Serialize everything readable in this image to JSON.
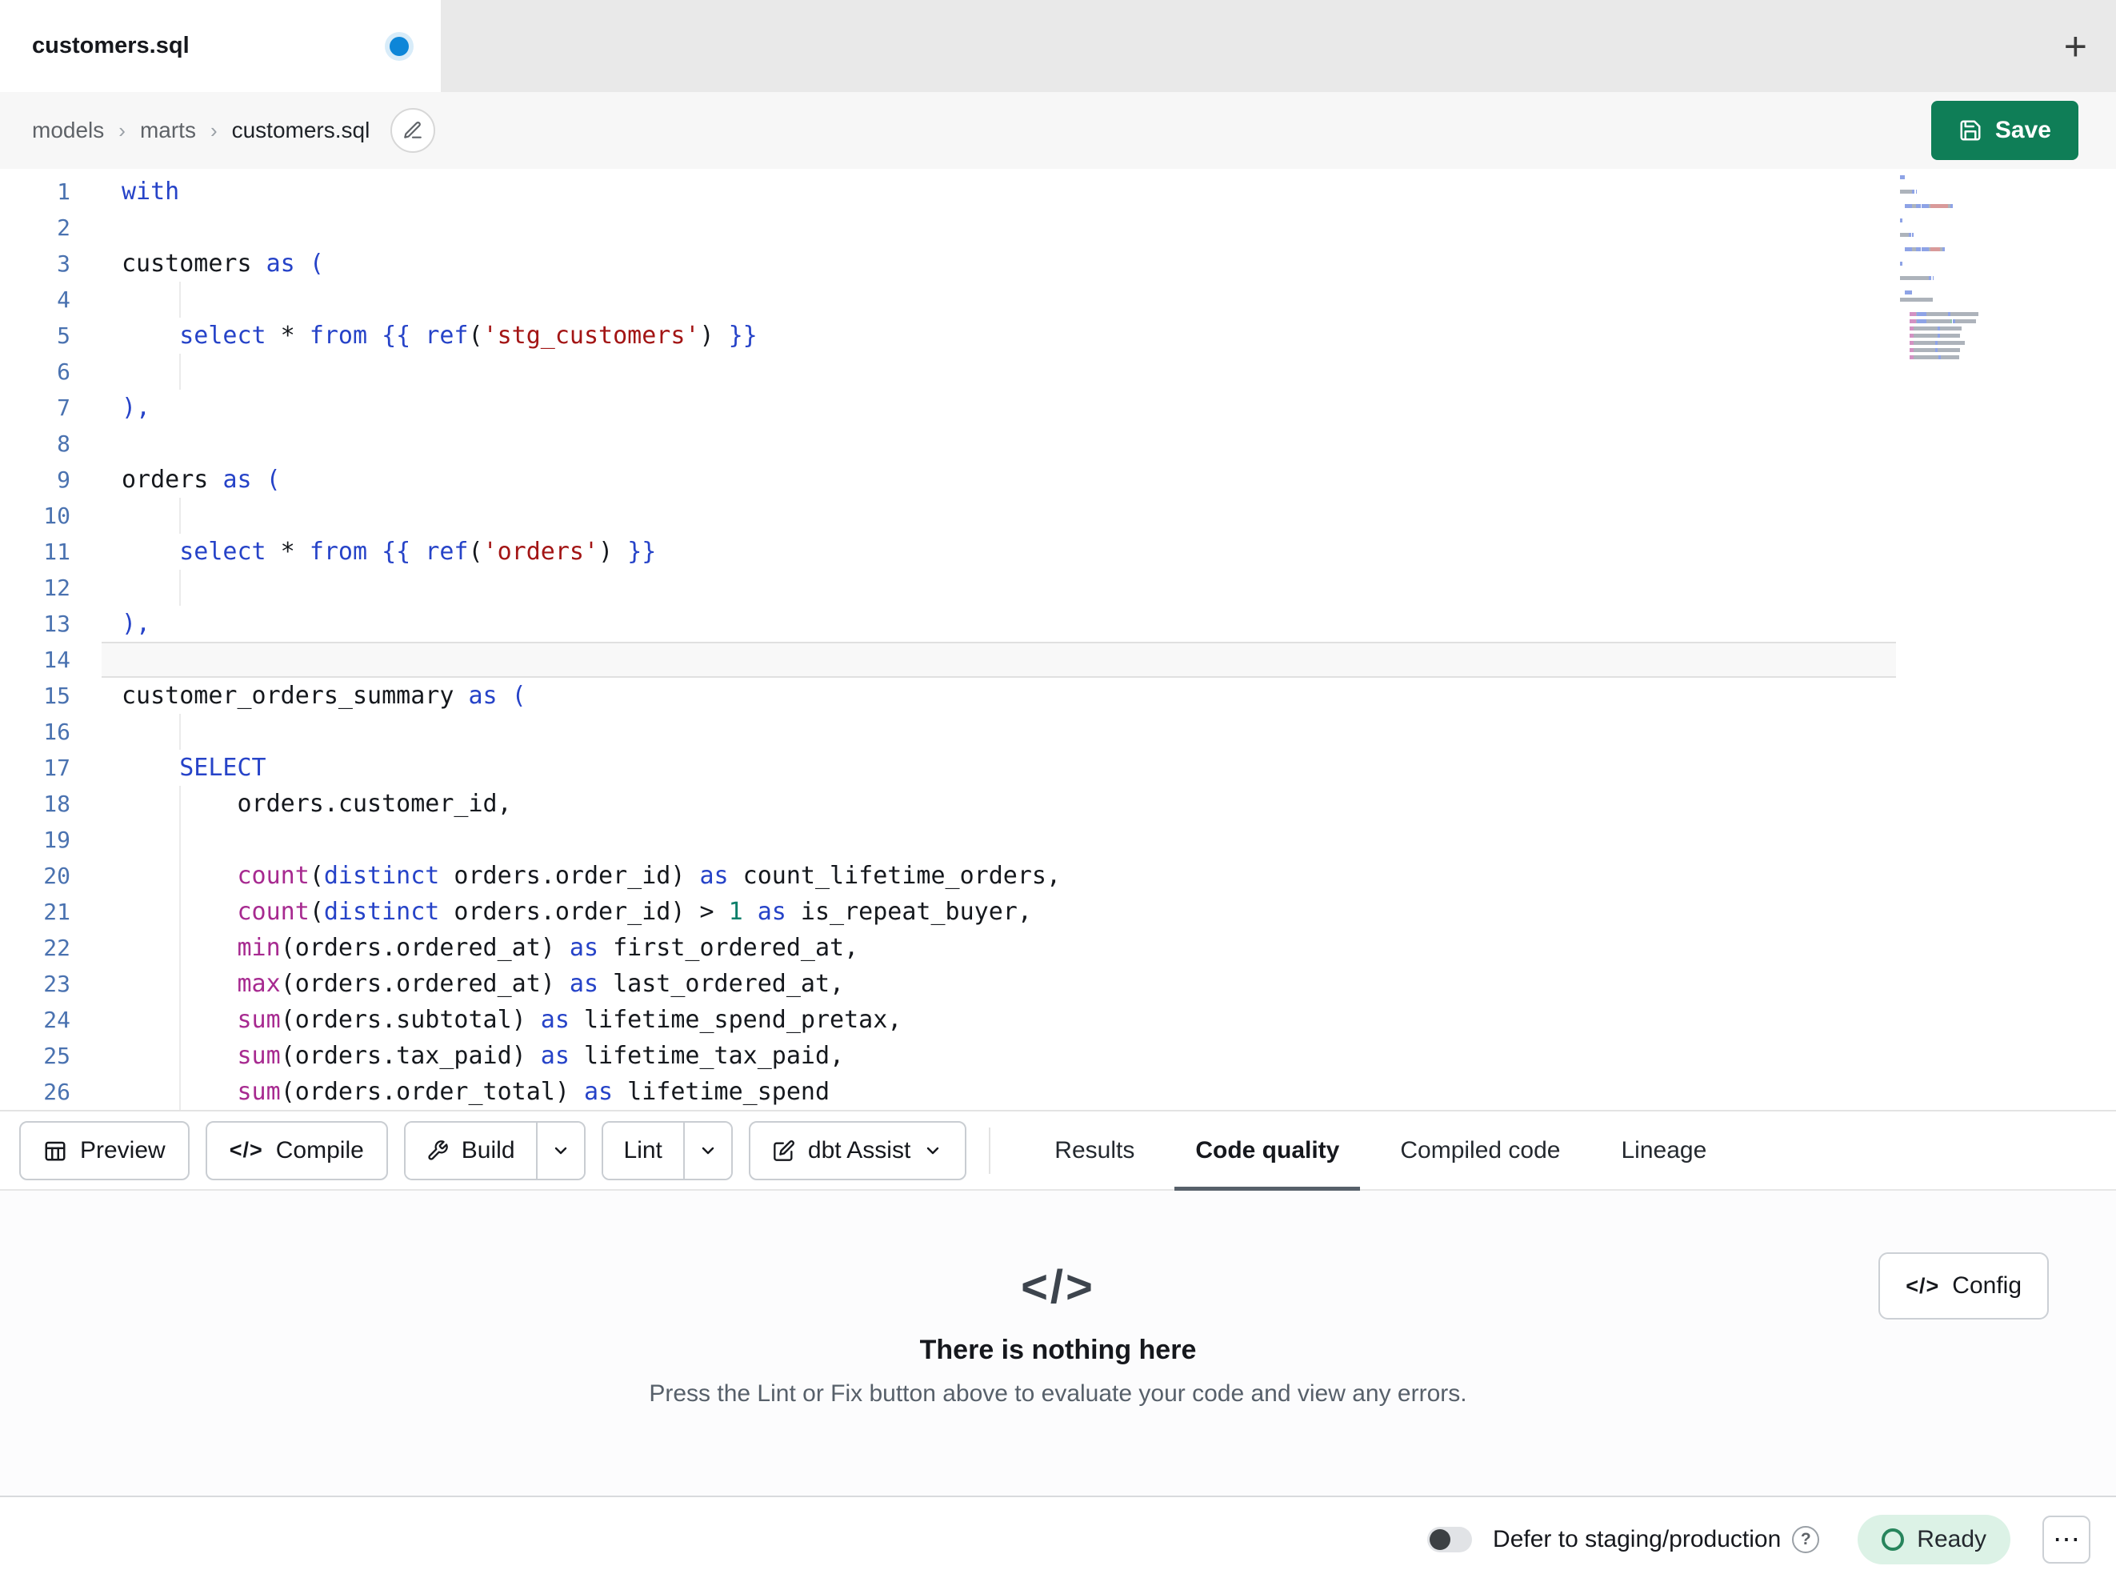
{
  "colors": {
    "accent_green": "#0f7e57",
    "keyword_blue": "#2643c8",
    "function_magenta": "#a72a90",
    "string_red": "#a31515",
    "number_teal": "#0b7f6a",
    "ready_green": "#27855c",
    "unsaved_dot_blue": "#0d86d8"
  },
  "window": {
    "tab_title": "customers.sql"
  },
  "icons": {
    "code_glyph": "</>",
    "plus_glyph": "+",
    "more_glyph": "⋯",
    "help_glyph": "?"
  },
  "breadcrumb": {
    "separator": "›",
    "items": [
      "models",
      "marts",
      "customers.sql"
    ]
  },
  "header": {
    "save_label": "Save"
  },
  "editor": {
    "lines": [
      {
        "n": 1,
        "t": [
          [
            "kw",
            "with"
          ]
        ]
      },
      {
        "n": 2,
        "t": []
      },
      {
        "n": 3,
        "t": [
          [
            "pl",
            "customers "
          ],
          [
            "kw",
            "as"
          ],
          [
            "pl",
            " "
          ],
          [
            "br",
            "("
          ]
        ]
      },
      {
        "n": 4,
        "t": [],
        "g": true
      },
      {
        "n": 5,
        "t": [
          [
            "pl",
            "    "
          ],
          [
            "kw",
            "select"
          ],
          [
            "pl",
            " * "
          ],
          [
            "kw",
            "from"
          ],
          [
            "pl",
            " "
          ],
          [
            "br",
            "{{ "
          ],
          [
            "kw",
            "ref"
          ],
          [
            "pl",
            "("
          ],
          [
            "st",
            "'stg_customers'"
          ],
          [
            "pl",
            ") "
          ],
          [
            "br",
            "}}"
          ]
        ]
      },
      {
        "n": 6,
        "t": [],
        "g": true
      },
      {
        "n": 7,
        "t": [
          [
            "br",
            "),"
          ]
        ]
      },
      {
        "n": 8,
        "t": []
      },
      {
        "n": 9,
        "t": [
          [
            "pl",
            "orders "
          ],
          [
            "kw",
            "as"
          ],
          [
            "pl",
            " "
          ],
          [
            "br",
            "("
          ]
        ]
      },
      {
        "n": 10,
        "t": [],
        "g": true
      },
      {
        "n": 11,
        "t": [
          [
            "pl",
            "    "
          ],
          [
            "kw",
            "select"
          ],
          [
            "pl",
            " * "
          ],
          [
            "kw",
            "from"
          ],
          [
            "pl",
            " "
          ],
          [
            "br",
            "{{ "
          ],
          [
            "kw",
            "ref"
          ],
          [
            "pl",
            "("
          ],
          [
            "st",
            "'orders'"
          ],
          [
            "pl",
            ") "
          ],
          [
            "br",
            "}}"
          ]
        ]
      },
      {
        "n": 12,
        "t": [],
        "g": true
      },
      {
        "n": 13,
        "t": [
          [
            "br",
            "),"
          ]
        ]
      },
      {
        "n": 14,
        "t": [],
        "a": true
      },
      {
        "n": 15,
        "t": [
          [
            "pl",
            "customer_orders_summary "
          ],
          [
            "kw",
            "as"
          ],
          [
            "pl",
            " "
          ],
          [
            "br",
            "("
          ]
        ]
      },
      {
        "n": 16,
        "t": [],
        "g": true
      },
      {
        "n": 17,
        "t": [
          [
            "pl",
            "    "
          ],
          [
            "kw",
            "SELECT"
          ]
        ]
      },
      {
        "n": 18,
        "t": [
          [
            "pl",
            "        orders.customer_id,"
          ]
        ],
        "g": true
      },
      {
        "n": 19,
        "t": [],
        "g": true
      },
      {
        "n": 20,
        "t": [
          [
            "pl",
            "        "
          ],
          [
            "fn",
            "count"
          ],
          [
            "pl",
            "("
          ],
          [
            "kw",
            "distinct"
          ],
          [
            "pl",
            " orders.order_id) "
          ],
          [
            "kw",
            "as"
          ],
          [
            "pl",
            " count_lifetime_orders,"
          ]
        ],
        "g": true
      },
      {
        "n": 21,
        "t": [
          [
            "pl",
            "        "
          ],
          [
            "fn",
            "count"
          ],
          [
            "pl",
            "("
          ],
          [
            "kw",
            "distinct"
          ],
          [
            "pl",
            " orders.order_id) > "
          ],
          [
            "nu",
            "1"
          ],
          [
            "pl",
            " "
          ],
          [
            "kw",
            "as"
          ],
          [
            "pl",
            " is_repeat_buyer,"
          ]
        ],
        "g": true
      },
      {
        "n": 22,
        "t": [
          [
            "pl",
            "        "
          ],
          [
            "fn",
            "min"
          ],
          [
            "pl",
            "(orders.ordered_at) "
          ],
          [
            "kw",
            "as"
          ],
          [
            "pl",
            " first_ordered_at,"
          ]
        ],
        "g": true
      },
      {
        "n": 23,
        "t": [
          [
            "pl",
            "        "
          ],
          [
            "fn",
            "max"
          ],
          [
            "pl",
            "(orders.ordered_at) "
          ],
          [
            "kw",
            "as"
          ],
          [
            "pl",
            " last_ordered_at,"
          ]
        ],
        "g": true
      },
      {
        "n": 24,
        "t": [
          [
            "pl",
            "        "
          ],
          [
            "fn",
            "sum"
          ],
          [
            "pl",
            "(orders.subtotal) "
          ],
          [
            "kw",
            "as"
          ],
          [
            "pl",
            " lifetime_spend_pretax,"
          ]
        ],
        "g": true
      },
      {
        "n": 25,
        "t": [
          [
            "pl",
            "        "
          ],
          [
            "fn",
            "sum"
          ],
          [
            "pl",
            "(orders.tax_paid) "
          ],
          [
            "kw",
            "as"
          ],
          [
            "pl",
            " lifetime_tax_paid,"
          ]
        ],
        "g": true
      },
      {
        "n": 26,
        "t": [
          [
            "pl",
            "        "
          ],
          [
            "fn",
            "sum"
          ],
          [
            "pl",
            "(orders.order_total) "
          ],
          [
            "kw",
            "as"
          ],
          [
            "pl",
            " lifetime_spend"
          ]
        ],
        "g": true
      }
    ]
  },
  "toolbar": {
    "preview_label": "Preview",
    "compile_label": "Compile",
    "build_label": "Build",
    "lint_label": "Lint",
    "assist_label": "dbt Assist"
  },
  "panel_tabs": [
    {
      "label": "Results",
      "active": false
    },
    {
      "label": "Code quality",
      "active": true
    },
    {
      "label": "Compiled code",
      "active": false
    },
    {
      "label": "Lineage",
      "active": false
    }
  ],
  "empty_state": {
    "title": "There is nothing here",
    "subtitle": "Press the Lint or Fix button above to evaluate your code and view any errors.",
    "config_label": "Config"
  },
  "status_bar": {
    "defer_label": "Defer to staging/production",
    "ready_label": "Ready"
  }
}
